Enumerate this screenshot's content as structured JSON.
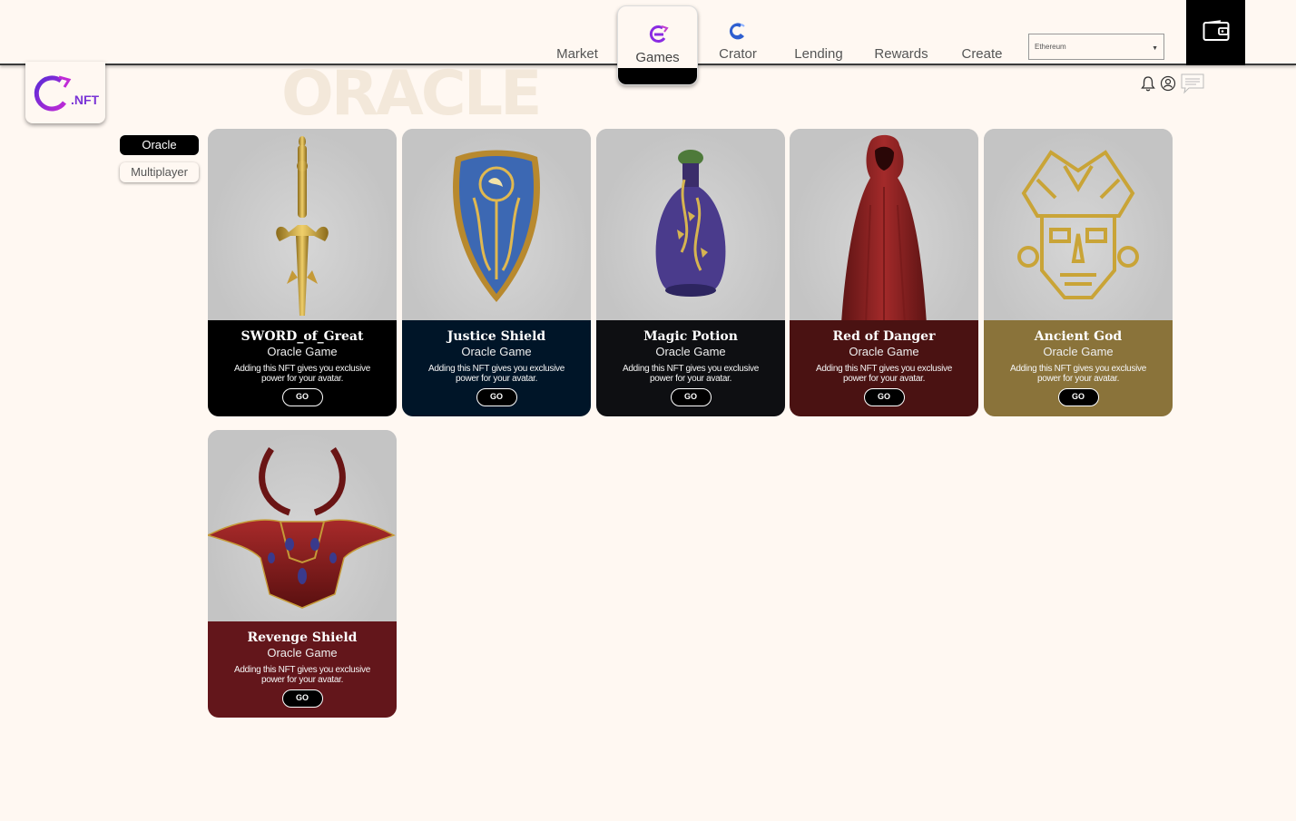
{
  "nav": {
    "items": [
      {
        "label": "Market",
        "icon": "none"
      },
      {
        "label": "Games",
        "icon": "games-logo-icon"
      },
      {
        "label": "Crator",
        "icon": "crator-logo-icon"
      },
      {
        "label": "Lending",
        "icon": "none"
      },
      {
        "label": "Rewards",
        "icon": "none"
      },
      {
        "label": "Create",
        "icon": "none"
      }
    ],
    "active": "Games",
    "network_select": {
      "value": "Ethereum"
    },
    "wallet_icon": "wallet-icon"
  },
  "logo": {
    "text": ".NFT",
    "brand_color": "#7a34d6"
  },
  "page_title": "ORACLE",
  "header_icons": [
    "bell-icon",
    "user-icon",
    "chat-icon"
  ],
  "side_tabs": [
    {
      "label": "Oracle",
      "active": true
    },
    {
      "label": "Multiplayer",
      "active": false
    }
  ],
  "cards": [
    {
      "name": "SWORD_of_Great",
      "game": "Oracle Game",
      "desc": "Adding this NFT gives you exclusive power for your avatar.",
      "go": "GO",
      "color": "#000000",
      "art": "sword"
    },
    {
      "name": "Justice Shield",
      "game": "Oracle Game",
      "desc": "Adding this NFT gives you exclusive power for your avatar.",
      "go": "GO",
      "color": "#001528",
      "art": "shield"
    },
    {
      "name": "Magic Potion",
      "game": "Oracle Game",
      "desc": "Adding this NFT gives you exclusive power for your avatar.",
      "go": "GO",
      "color": "#0e0f12",
      "art": "potion"
    },
    {
      "name": "Red of Danger",
      "game": "Oracle Game",
      "desc": "Adding this NFT gives you exclusive power for your avatar.",
      "go": "GO",
      "color": "#4a1212",
      "art": "cloak"
    },
    {
      "name": "Ancient God",
      "game": "Oracle Game",
      "desc": "Adding this NFT gives you exclusive power for your avatar.",
      "go": "GO",
      "color": "#8a733a",
      "art": "mask"
    },
    {
      "name": "Revenge Shield",
      "game": "Oracle Game",
      "desc": "Adding this NFT gives you exclusive power for your avatar.",
      "go": "GO",
      "color": "#63161b",
      "art": "helmet"
    }
  ]
}
